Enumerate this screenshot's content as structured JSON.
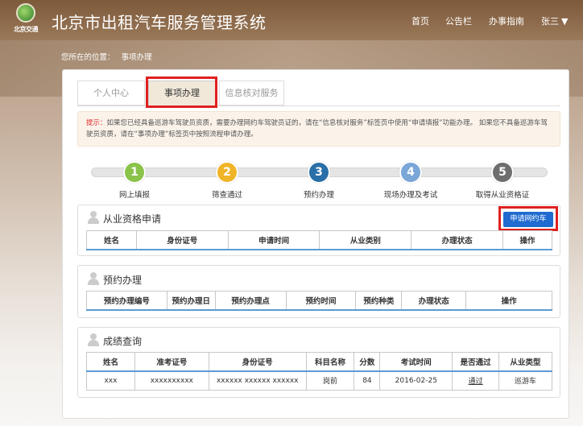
{
  "header": {
    "logo_text": "北京交通",
    "site_title": "北京市出租汽车服务管理系统",
    "nav": [
      "首页",
      "公告栏",
      "办事指南"
    ],
    "user_name": "张三"
  },
  "breadcrumb": {
    "prefix": "您所在的位置：",
    "current": "事项办理"
  },
  "tabs": [
    "个人中心",
    "事项办理",
    "信息核对服务"
  ],
  "notice": {
    "label": "提示：",
    "text": "如果您已经具备巡游车驾驶员资质，需要办理网约车驾驶员证的，请在“信息核对服务”标签页中使用“申请填报”功能办理。 如果您不具备巡游车驾驶员资质，请在“事项办理”标签页中按照流程申请办理。"
  },
  "steps": [
    {
      "num": "1",
      "label": "网上填报",
      "color": "#8bc34a"
    },
    {
      "num": "2",
      "label": "筛查通过",
      "color": "#f0b429"
    },
    {
      "num": "3",
      "label": "预约办理",
      "color": "#2a6fa8"
    },
    {
      "num": "4",
      "label": "现场办理及考试",
      "color": "#7aa6d8"
    },
    {
      "num": "5",
      "label": "取得从业资格证",
      "color": "#6e6e6e"
    }
  ],
  "qualification": {
    "title": "从业资格申请",
    "apply_button": "申请网约车",
    "columns": [
      "姓名",
      "身份证号",
      "申请时间",
      "从业类别",
      "办理状态",
      "操作"
    ]
  },
  "appointment": {
    "title": "预约办理",
    "columns": [
      "预约办理编号",
      "预约办理日",
      "预约办理点",
      "预约时间",
      "预约种类",
      "办理状态",
      "操作"
    ]
  },
  "scores": {
    "title": "成绩查询",
    "columns": [
      "姓名",
      "准考证号",
      "身份证号",
      "科目名称",
      "分数",
      "考试时间",
      "是否通过",
      "从业类型"
    ],
    "rows": [
      [
        "xxx",
        "xxxxxxxxxx",
        "xxxxxx xxxxxx xxxxxx",
        "岗前",
        "84",
        "2016-02-25",
        "通过",
        "巡游车"
      ]
    ]
  }
}
